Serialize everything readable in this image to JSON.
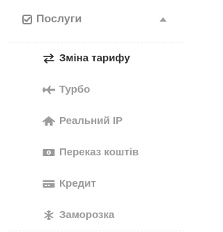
{
  "menu": {
    "title": "Послуги",
    "expanded": true,
    "header_icon": "check-square-icon",
    "items": [
      {
        "label": "Зміна тарифу",
        "icon": "exchange-icon",
        "active": true
      },
      {
        "label": "Турбо",
        "icon": "plane-icon",
        "active": false
      },
      {
        "label": "Реальний IP",
        "icon": "home-icon",
        "active": false
      },
      {
        "label": "Переказ коштів",
        "icon": "money-bill-icon",
        "active": false
      },
      {
        "label": "Кредит",
        "icon": "credit-card-icon",
        "active": false
      },
      {
        "label": "Заморозка",
        "icon": "snowflake-icon",
        "active": false
      }
    ]
  },
  "colors": {
    "active_text": "#333333",
    "inactive_text": "#9b9b9b",
    "header_text": "#8a8a8a",
    "divider": "#e8e8e8"
  }
}
